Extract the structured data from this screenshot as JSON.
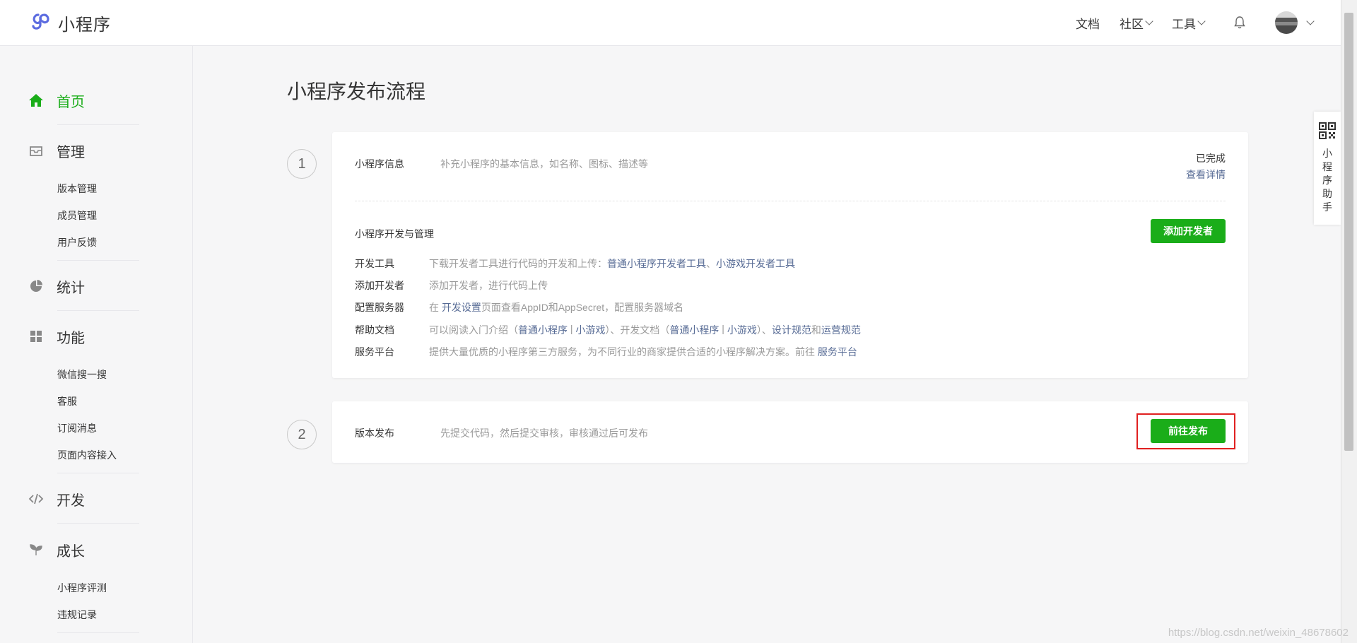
{
  "header": {
    "logo_text": "小程序",
    "nav": [
      {
        "label": "文档"
      },
      {
        "label": "社区"
      },
      {
        "label": "工具"
      }
    ]
  },
  "sidebar": {
    "home": "首页",
    "manage": {
      "label": "管理",
      "items": [
        "版本管理",
        "成员管理",
        "用户反馈"
      ]
    },
    "stats": {
      "label": "统计"
    },
    "features": {
      "label": "功能",
      "items": [
        "微信搜一搜",
        "客服",
        "订阅消息",
        "页面内容接入"
      ]
    },
    "dev": {
      "label": "开发"
    },
    "growth": {
      "label": "成长",
      "items": [
        "小程序评测",
        "违规记录"
      ]
    }
  },
  "main": {
    "title": "小程序发布流程",
    "step1": {
      "number": "1",
      "title": "小程序信息",
      "desc": "补充小程序的基本信息，如名称、图标、描述等",
      "status": "已完成",
      "detail_link": "查看详情",
      "dev_title": "小程序开发与管理",
      "add_dev_button": "添加开发者",
      "rows": {
        "tools": {
          "label": "开发工具",
          "text": "下载开发者工具进行代码的开发和上传：",
          "link1": "普通小程序开发者工具",
          "sep": "、",
          "link2": "小游戏开发者工具"
        },
        "add_dev": {
          "label": "添加开发者",
          "text": "添加开发者，进行代码上传"
        },
        "server": {
          "label": "配置服务器",
          "pre": "在 ",
          "link": "开发设置",
          "post": "页面查看AppID和AppSecret，配置服务器域名"
        },
        "help": {
          "label": "帮助文档",
          "pre": "可以阅读入门介绍（",
          "link1": "普通小程序",
          "pipe": " | ",
          "link2": "小游戏",
          "mid": "）、开发文档（",
          "link3": "普通小程序",
          "link4": "小游戏",
          "mid2": "）、",
          "link5": "设计规范",
          "and": "和",
          "link6": "运营规范"
        },
        "service": {
          "label": "服务平台",
          "text": "提供大量优质的小程序第三方服务，为不同行业的商家提供合适的小程序解决方案。前往 ",
          "link": "服务平台"
        }
      }
    },
    "step2": {
      "number": "2",
      "title": "版本发布",
      "desc": "先提交代码，然后提交审核，审核通过后可发布",
      "publish_button": "前往发布"
    }
  },
  "helper": {
    "text": "小程序助手"
  },
  "watermark": "https://blog.csdn.net/weixin_48678602",
  "colors": {
    "accent": "#1aad19",
    "link": "#576b95",
    "highlight": "#e02020"
  }
}
